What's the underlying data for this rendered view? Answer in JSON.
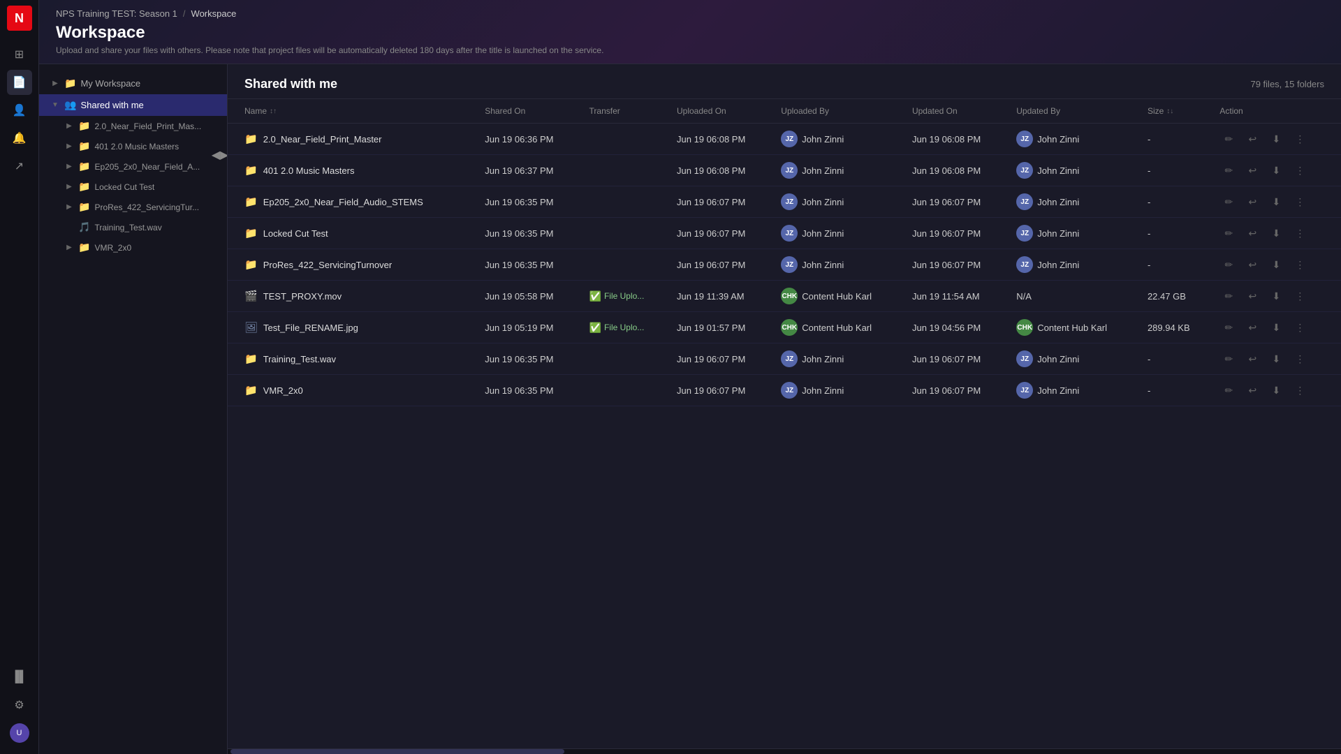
{
  "app": {
    "logo": "N",
    "logo_color": "#e50914"
  },
  "breadcrumb": {
    "parent": "NPS Training TEST: Season 1",
    "separator": "/",
    "current": "Workspace"
  },
  "page": {
    "title": "Workspace",
    "subtitle": "Upload and share your files with others. Please note that project files will be automatically deleted 180 days after the title is launched on the service."
  },
  "sidebar": {
    "items": [
      {
        "id": "my-workspace",
        "label": "My Workspace",
        "icon": "📁",
        "expanded": false,
        "active": false,
        "level": 0
      },
      {
        "id": "shared-with-me",
        "label": "Shared with me",
        "icon": "👥",
        "expanded": true,
        "active": true,
        "level": 0
      },
      {
        "id": "near-field",
        "label": "2.0_Near_Field_Print_Mas...",
        "icon": "📁",
        "expanded": false,
        "active": false,
        "level": 1
      },
      {
        "id": "music-masters",
        "label": "401 2.0 Music Masters",
        "icon": "📁",
        "expanded": false,
        "active": false,
        "level": 1
      },
      {
        "id": "ep205",
        "label": "Ep205_2x0_Near_Field_A...",
        "icon": "📁",
        "expanded": false,
        "active": false,
        "level": 1
      },
      {
        "id": "locked-cut",
        "label": "Locked Cut Test",
        "icon": "📁",
        "expanded": false,
        "active": false,
        "level": 1
      },
      {
        "id": "prores",
        "label": "ProRes_422_ServicingTur...",
        "icon": "📁",
        "expanded": false,
        "active": false,
        "level": 1
      },
      {
        "id": "training-wav",
        "label": "Training_Test.wav",
        "icon": "🎵",
        "expanded": false,
        "active": false,
        "level": 1
      },
      {
        "id": "vmr2x0",
        "label": "VMR_2x0",
        "icon": "📁",
        "expanded": false,
        "active": false,
        "level": 1
      }
    ]
  },
  "file_area": {
    "title": "Shared with me",
    "file_count": "79 files, 15 folders"
  },
  "table": {
    "columns": [
      {
        "id": "name",
        "label": "Name",
        "sortable": true,
        "sort_indicator": "↕↑"
      },
      {
        "id": "shared_on",
        "label": "Shared On",
        "sortable": false
      },
      {
        "id": "transfer",
        "label": "Transfer",
        "sortable": false
      },
      {
        "id": "uploaded_on",
        "label": "Uploaded On",
        "sortable": false
      },
      {
        "id": "uploaded_by",
        "label": "Uploaded By",
        "sortable": false
      },
      {
        "id": "updated_on",
        "label": "Updated On",
        "sortable": false
      },
      {
        "id": "updated_by",
        "label": "Updated By",
        "sortable": false
      },
      {
        "id": "size",
        "label": "Size",
        "sortable": true,
        "sort_indicator": "↕↓"
      },
      {
        "id": "action",
        "label": "Action",
        "sortable": false
      }
    ],
    "rows": [
      {
        "name": "2.0_Near_Field_Print_Master",
        "type": "folder",
        "shared_on": "Jun 19 06:36 PM",
        "transfer": "",
        "uploaded_on": "Jun 19 06:08 PM",
        "uploaded_by": "John Zinni",
        "uploaded_by_initials": "JZ",
        "updated_on": "Jun 19 06:08 PM",
        "updated_by": "John Zinni",
        "updated_by_initials": "JZ",
        "size": "-"
      },
      {
        "name": "401 2.0 Music Masters",
        "type": "folder",
        "shared_on": "Jun 19 06:37 PM",
        "transfer": "",
        "uploaded_on": "Jun 19 06:08 PM",
        "uploaded_by": "John Zinni",
        "uploaded_by_initials": "JZ",
        "updated_on": "Jun 19 06:08 PM",
        "updated_by": "John Zinni",
        "updated_by_initials": "JZ",
        "size": "-"
      },
      {
        "name": "Ep205_2x0_Near_Field_Audio_STEMS",
        "type": "folder",
        "shared_on": "Jun 19 06:35 PM",
        "transfer": "",
        "uploaded_on": "Jun 19 06:07 PM",
        "uploaded_by": "John Zinni",
        "uploaded_by_initials": "JZ",
        "updated_on": "Jun 19 06:07 PM",
        "updated_by": "John Zinni",
        "updated_by_initials": "JZ",
        "size": "-"
      },
      {
        "name": "Locked Cut Test",
        "type": "folder",
        "shared_on": "Jun 19 06:35 PM",
        "transfer": "",
        "uploaded_on": "Jun 19 06:07 PM",
        "uploaded_by": "John Zinni",
        "uploaded_by_initials": "JZ",
        "updated_on": "Jun 19 06:07 PM",
        "updated_by": "John Zinni",
        "updated_by_initials": "JZ",
        "size": "-"
      },
      {
        "name": "ProRes_422_ServicingTurnover",
        "type": "folder",
        "shared_on": "Jun 19 06:35 PM",
        "transfer": "",
        "uploaded_on": "Jun 19 06:07 PM",
        "uploaded_by": "John Zinni",
        "uploaded_by_initials": "JZ",
        "updated_on": "Jun 19 06:07 PM",
        "updated_by": "John Zinni",
        "updated_by_initials": "JZ",
        "size": "-"
      },
      {
        "name": "TEST_PROXY.mov",
        "type": "video",
        "shared_on": "Jun 19 05:58 PM",
        "transfer": "File Uplo...",
        "transfer_status": "complete",
        "uploaded_on": "Jun 19 11:39 AM",
        "uploaded_by": "Content Hub Karl",
        "uploaded_by_initials": "CHK",
        "updated_on": "Jun 19 11:54 AM",
        "updated_by": "N/A",
        "updated_by_initials": "",
        "size": "22.47 GB"
      },
      {
        "name": "Test_File_RENAME.jpg",
        "type": "image",
        "shared_on": "Jun 19 05:19 PM",
        "transfer": "File Uplo...",
        "transfer_status": "complete",
        "uploaded_on": "Jun 19 01:57 PM",
        "uploaded_by": "Content Hub Karl",
        "uploaded_by_initials": "CHK",
        "updated_on": "Jun 19 04:56 PM",
        "updated_by": "Content Hub Karl",
        "updated_by_initials": "CHK",
        "size": "289.94 KB"
      },
      {
        "name": "Training_Test.wav",
        "type": "folder",
        "shared_on": "Jun 19 06:35 PM",
        "transfer": "",
        "uploaded_on": "Jun 19 06:07 PM",
        "uploaded_by": "John Zinni",
        "uploaded_by_initials": "JZ",
        "updated_on": "Jun 19 06:07 PM",
        "updated_by": "John Zinni",
        "updated_by_initials": "JZ",
        "size": "-"
      },
      {
        "name": "VMR_2x0",
        "type": "folder",
        "shared_on": "Jun 19 06:35 PM",
        "transfer": "",
        "uploaded_on": "Jun 19 06:07 PM",
        "uploaded_by": "John Zinni",
        "uploaded_by_initials": "JZ",
        "updated_on": "Jun 19 06:07 PM",
        "updated_by": "John Zinni",
        "updated_by_initials": "JZ",
        "size": "-"
      }
    ]
  },
  "icons": {
    "folder": "📁",
    "video": "🎬",
    "image": "🖼",
    "audio": "🎵",
    "edit": "✏",
    "share": "↩",
    "download": "⬇",
    "more": "⋮",
    "expand_right": "▶",
    "expand_down": "▼",
    "collapse": "◀",
    "grid": "⊞",
    "files": "📄",
    "settings": "⚙",
    "user": "👤",
    "bell": "🔔",
    "panel": "▐▌"
  }
}
